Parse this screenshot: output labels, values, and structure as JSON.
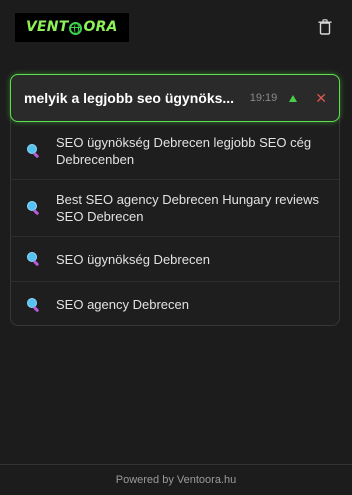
{
  "header": {
    "logo_text_left": "VENT",
    "logo_text_right": "ORA",
    "trash_icon": "trash-icon"
  },
  "query": {
    "text": "melyik a legjobb seo ügynöks...",
    "time": "19:19",
    "up_icon": "caret-up-icon",
    "close_label": "✕"
  },
  "suggestions": [
    {
      "label": "SEO ügynökség Debrecen legjobb SEO cég Debrecenben",
      "icon": "magnifier-icon"
    },
    {
      "label": "Best SEO agency Debrecen Hungary reviews SEO Debrecen",
      "icon": "magnifier-icon"
    },
    {
      "label": "SEO ügynökség Debrecen",
      "icon": "magnifier-icon"
    },
    {
      "label": "SEO agency Debrecen",
      "icon": "magnifier-icon"
    }
  ],
  "footer": {
    "text": "Powered by Ventoora.hu"
  },
  "colors": {
    "accent": "#5be14b",
    "background": "#1c1c1c",
    "close": "#e0554f",
    "logo_green": "#8ef05a"
  }
}
